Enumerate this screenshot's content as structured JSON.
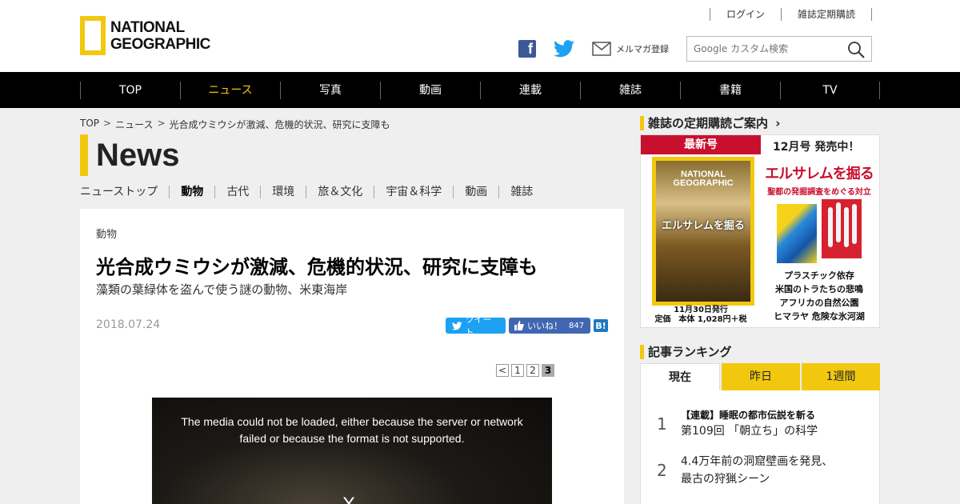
{
  "header": {
    "logo_line1": "NATIONAL",
    "logo_line2": "GEOGRAPHIC",
    "top_links": [
      "ログイン",
      "雑誌定期購読"
    ],
    "mail_label": "メルマガ登録",
    "search_placeholder": "Google カスタム検索"
  },
  "nav": {
    "items": [
      "TOP",
      "ニュース",
      "写真",
      "動画",
      "連載",
      "雑誌",
      "書籍",
      "TV"
    ],
    "active": "ニュース"
  },
  "breadcrumb": [
    "TOP",
    "ニュース",
    "光合成ウミウシが激減、危機的状況、研究に支障も"
  ],
  "section_title": "News",
  "subnav": [
    "ニューストップ",
    "動物",
    "古代",
    "環境",
    "旅＆文化",
    "宇宙＆科学",
    "動画",
    "雑誌"
  ],
  "subnav_active": "動物",
  "article": {
    "category": "動物",
    "headline": "光合成ウミウシが激減、危機的状況、研究に支障も",
    "subhead": "藻類の葉緑体を盗んで使う謎の動物、米東海岸",
    "date": "2018.07.24",
    "tweet_label": "ツイート",
    "like_label": "いいね！",
    "like_count": "847",
    "hatena_label": "B!",
    "pager": [
      "<",
      "1",
      "2",
      "3"
    ],
    "pager_current": "3",
    "video_message_line1": "The media could not be loaded, either because the server or network",
    "video_message_line2": "failed or because the format is not supported.",
    "video_close": "X"
  },
  "sidebar": {
    "subscribe_heading": "雑誌の定期購読ご案内",
    "new_issue": "最新号",
    "issue_text": "12月号 発売中！",
    "cover_logo1": "NATIONAL",
    "cover_logo2": "GEOGRAPHIC",
    "cover_title": "エルサレムを掘る",
    "cover_caption1": "11月30日発行",
    "cover_caption2": "定価　本体 1,028円＋税",
    "feature_title": "エルサレムを掘る",
    "feature_sub": "聖都の発掘調査をめぐる対立",
    "features": [
      "プラスチック依存",
      "米国のトラたちの悲鳴",
      "アフリカの自然公園",
      "ヒマラヤ 危険な氷河湖"
    ],
    "ranking_heading": "記事ランキング",
    "ranking_tabs": [
      "現在",
      "昨日",
      "1週間"
    ],
    "ranking": [
      {
        "num": "1",
        "series": "【連載】睡眠の都市伝説を斬る",
        "line1": "第109回 「朝立ち」の科学",
        "line2": ""
      },
      {
        "num": "2",
        "series": "",
        "line1": "4.4万年前の洞窟壁画を発見、",
        "line2": "最古の狩猟シーン"
      }
    ]
  },
  "colors": {
    "accent": "#f2c80f",
    "nav_bg": "#000000",
    "facebook": "#3b5998",
    "twitter": "#1da1f2",
    "magazine_red": "#c8102e"
  }
}
